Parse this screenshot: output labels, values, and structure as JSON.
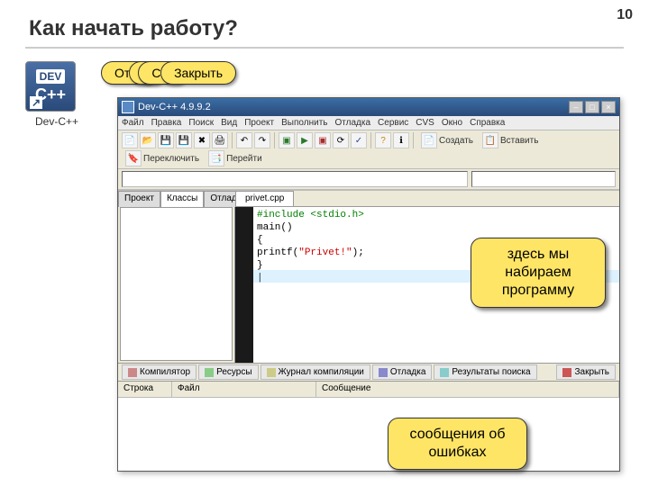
{
  "page_number": "10",
  "title": "Как начать работу?",
  "logo": {
    "line1": "DEV",
    "line2": "C++",
    "label": "Dev-C++"
  },
  "bubbles": [
    "Откр",
    "Н",
    "Сох",
    "Закрыть"
  ],
  "window": {
    "title": "Dev-C++ 4.9.9.2",
    "menu": [
      "Файл",
      "Правка",
      "Поиск",
      "Вид",
      "Проект",
      "Выполнить",
      "Отладка",
      "Сервис",
      "CVS",
      "Окно",
      "Справка"
    ],
    "toolbar_labels": {
      "create": "Создать",
      "insert": "Вставить",
      "switch": "Переключить",
      "goto": "Перейти"
    },
    "left_tabs": [
      "Проект",
      "Классы",
      "Отладка"
    ],
    "editor_tab": "privet.cpp",
    "code_lines": [
      {
        "cls": "include",
        "text": "#include <stdio.h>"
      },
      {
        "cls": "",
        "text": "main()"
      },
      {
        "cls": "",
        "text": "{"
      },
      {
        "cls": "",
        "text": "printf(\"Privet!\");"
      },
      {
        "cls": "",
        "text": "}"
      }
    ],
    "bottom_tabs": [
      "Компилятор",
      "Ресурсы",
      "Журнал компиляции",
      "Отладка",
      "Результаты поиска",
      "Закрыть"
    ],
    "msg_cols": [
      "Строка",
      "Файл",
      "Сообщение"
    ]
  },
  "callouts": {
    "c1": "здесь мы набираем программу",
    "c2": "сообщения об ошибках"
  }
}
